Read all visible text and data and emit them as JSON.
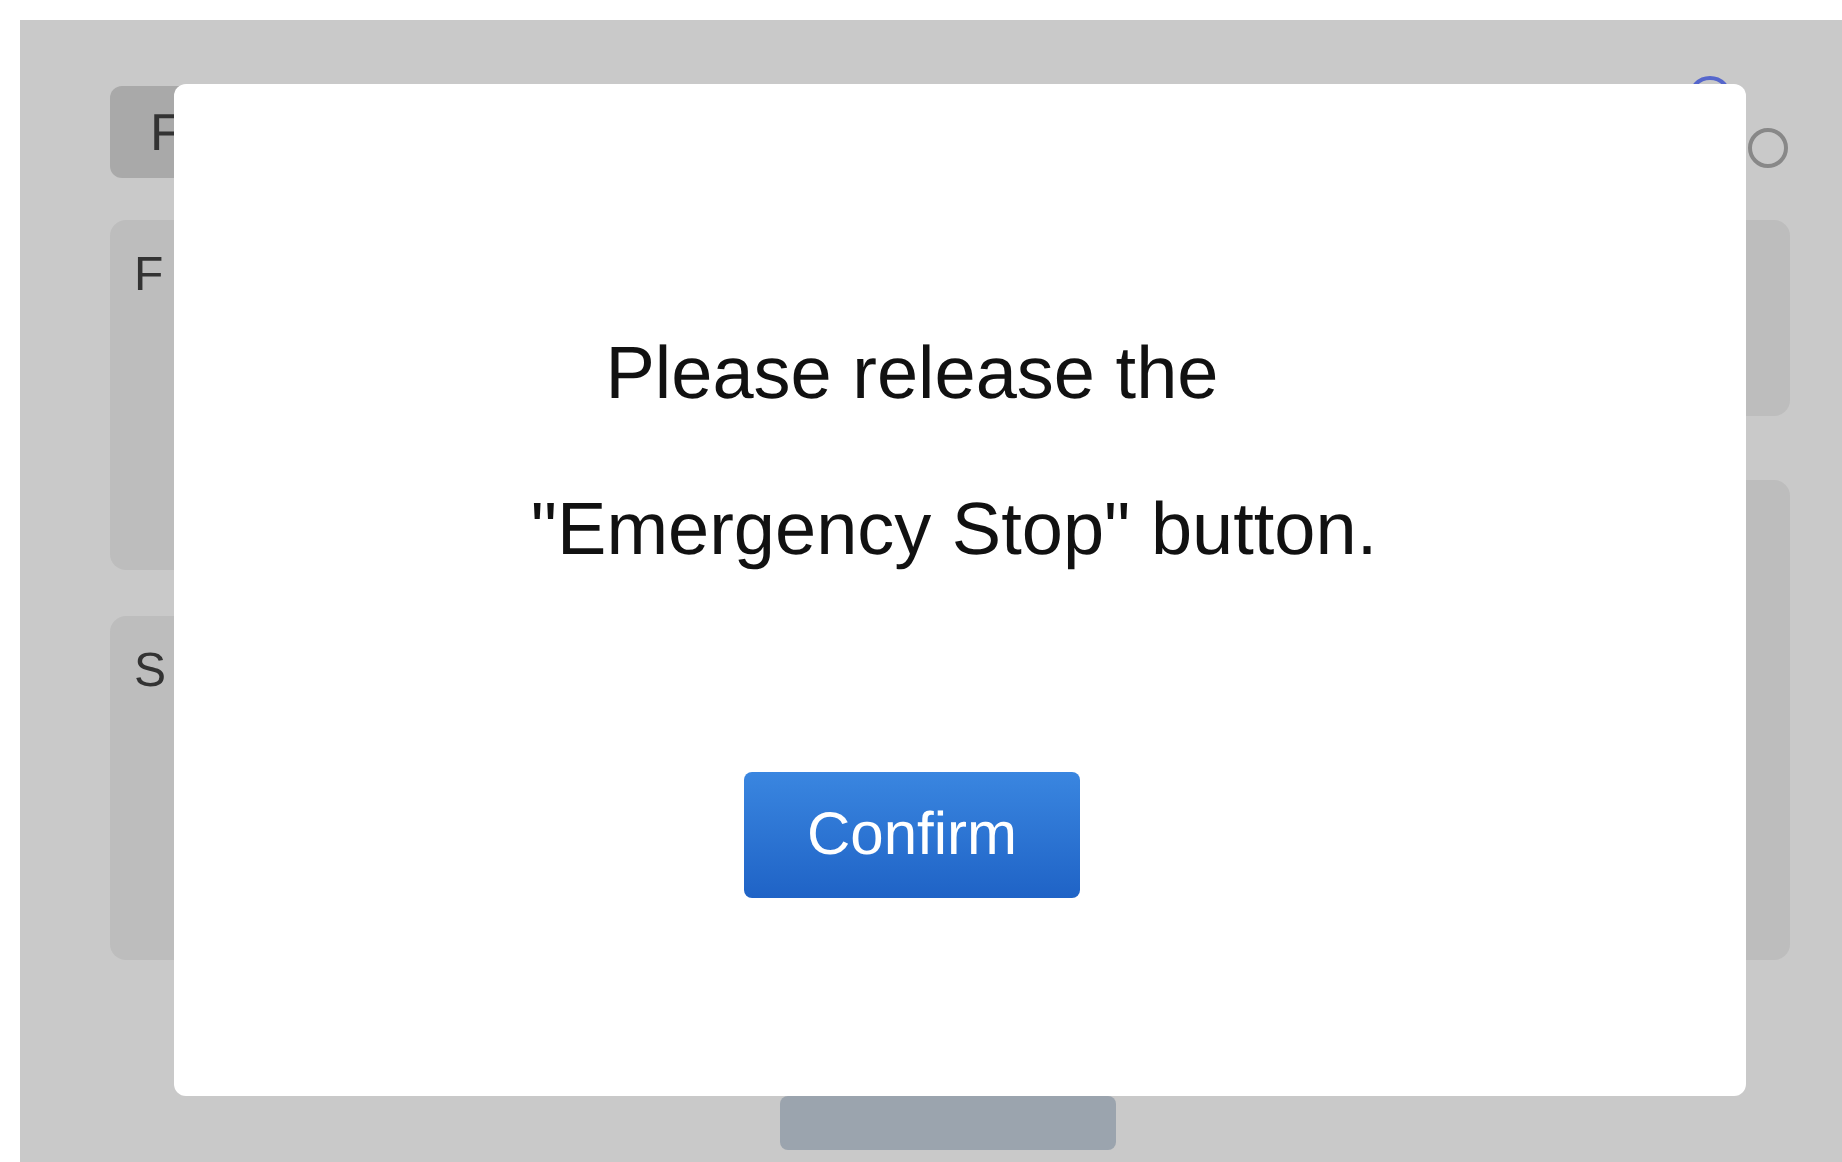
{
  "background": {
    "tab": "F",
    "panels": [
      {
        "label": "F"
      },
      {
        "label": "S"
      }
    ]
  },
  "dialog": {
    "message_lines": [
      "Please release the",
      "\"Emergency Stop\" button."
    ],
    "button": "Confirm"
  }
}
